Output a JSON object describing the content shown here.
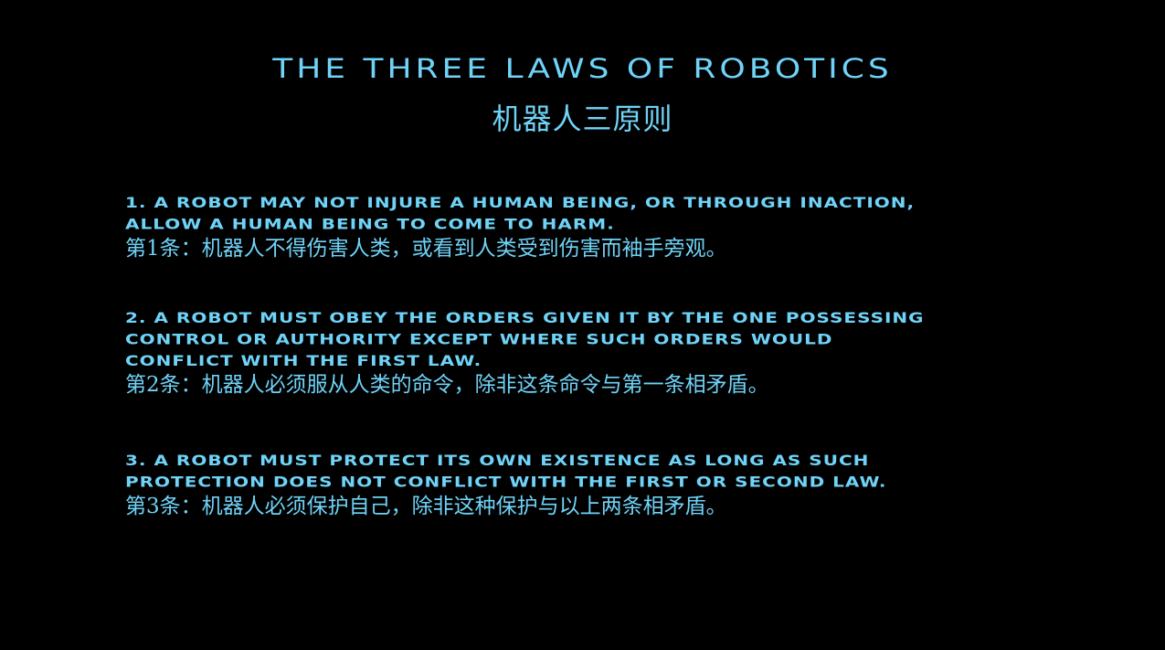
{
  "title_en": "THE THREE LAWS OF ROBOTICS",
  "title_cn": "机器人三原则",
  "laws": [
    {
      "en_lines": [
        "1. A ROBOT MAY NOT INJURE A HUMAN BEING, OR THROUGH INACTION,",
        "ALLOW A HUMAN BEING TO COME TO HARM."
      ],
      "cn": "第1条：机器人不得伤害人类，或看到人类受到伤害而袖手旁观。"
    },
    {
      "en_lines": [
        "2. A ROBOT MUST OBEY THE ORDERS GIVEN IT BY THE ONE POSSESSING",
        "CONTROL OR AUTHORITY EXCEPT WHERE SUCH ORDERS WOULD",
        "CONFLICT WITH THE FIRST LAW."
      ],
      "cn": "第2条：机器人必须服从人类的命令，除非这条命令与第一条相矛盾。"
    },
    {
      "en_lines": [
        "3. A ROBOT MUST PROTECT ITS OWN EXISTENCE AS LONG AS SUCH",
        "PROTECTION DOES NOT CONFLICT WITH THE FIRST OR SECOND LAW."
      ],
      "cn": "第3条：机器人必须保护自己，除非这种保护与以上两条相矛盾。"
    }
  ],
  "colors": {
    "background": "#000000",
    "text": "#6fd3f7"
  }
}
